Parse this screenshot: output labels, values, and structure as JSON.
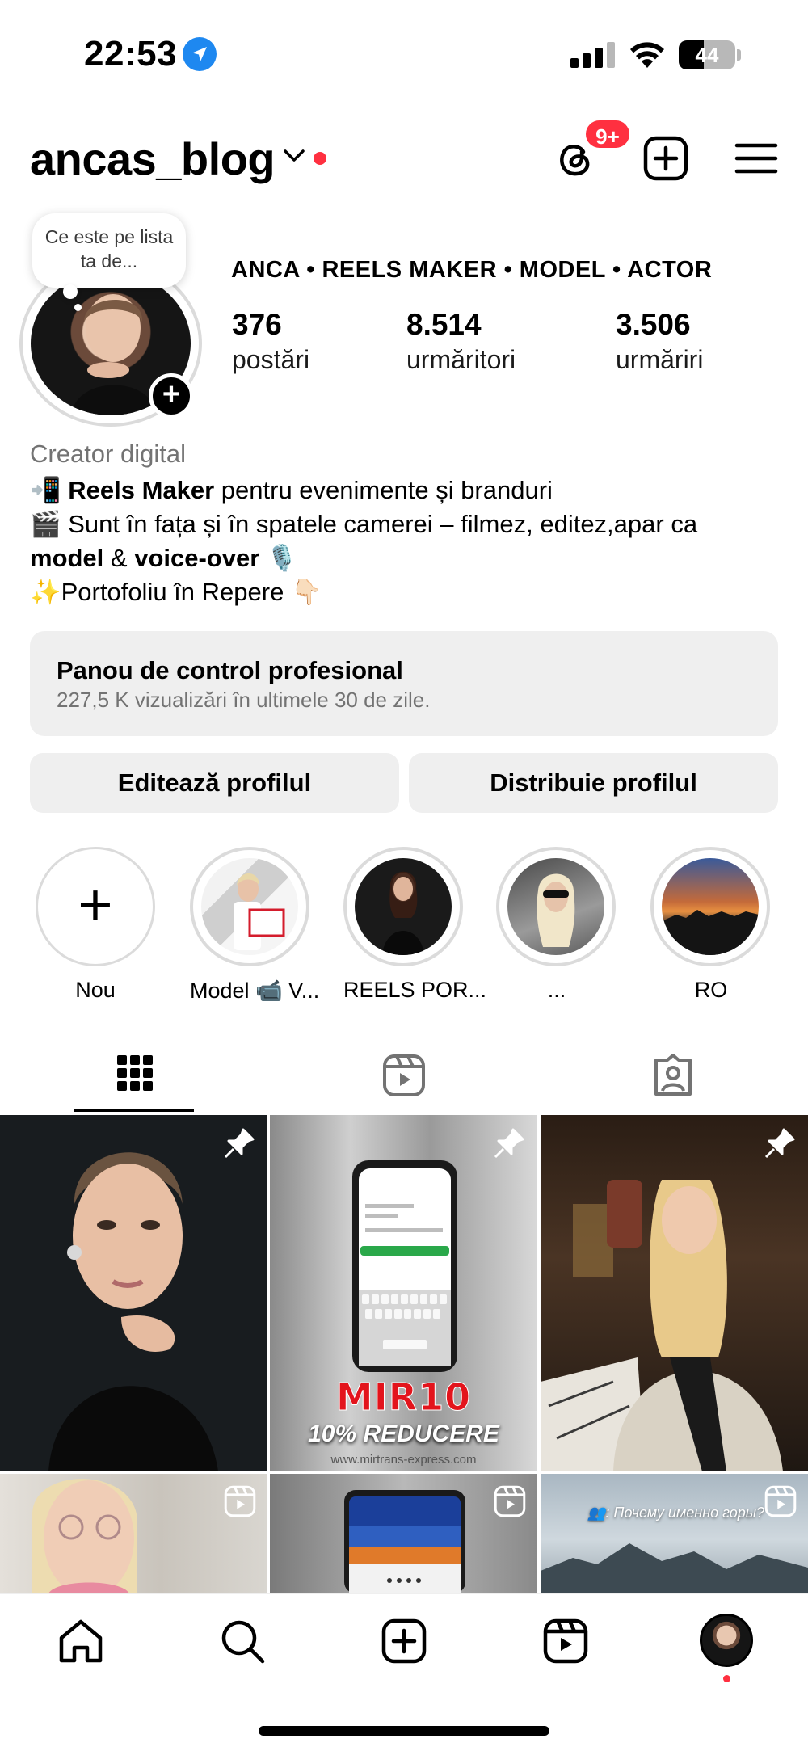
{
  "status_bar": {
    "time": "22:53",
    "battery": "44",
    "battery_level_percent": 44
  },
  "header": {
    "username": "ancas_blog",
    "threads_badge": "9+"
  },
  "profile": {
    "note": "Ce este pe lista ta de...",
    "display_name": "ANCA • REELS MAKER • MODEL • ACTOR",
    "stats": [
      {
        "value": "376",
        "label": "postări"
      },
      {
        "value": "8.514",
        "label": "urmăritori"
      },
      {
        "value": "3.506",
        "label": "urmăriri"
      }
    ],
    "category": "Creator digital",
    "bio": {
      "line1_emoji": "📲",
      "line1_bold": "Reels Maker",
      "line1_rest": " pentru evenimente și branduri",
      "line2_emoji": "🎬",
      "line2_text": " Sunt în fața și în spatele camerei – filmez, editez,apar ca",
      "line3_bold1": "model",
      "line3_mid": " & ",
      "line3_bold2": "voice-over",
      "line3_emoji": " 🎙️",
      "line4_emoji": "✨",
      "line4_text": "Portofoliu în Repere ",
      "line4_emoji2": "👇🏻"
    }
  },
  "dashboard": {
    "title": "Panou de control profesional",
    "subtitle": "227,5 K vizualizări în ultimele 30 de zile."
  },
  "buttons": {
    "edit": "Editează profilul",
    "share": "Distribuie profilul"
  },
  "highlights": [
    {
      "label": "Nou"
    },
    {
      "label": "Model 📹 V..."
    },
    {
      "label": "REELS POR..."
    },
    {
      "label": "..."
    },
    {
      "label": "RO"
    }
  ],
  "grid": {
    "tile2_title": "MIR10",
    "tile2_subtitle": "10% REDUCERE",
    "tile2_url": "www.mirtrans-express.com",
    "tile6_caption": "👥: Почему именно горы?"
  },
  "colors": {
    "accent_red": "#ff3040",
    "location_blue": "#1e88f0",
    "panel_gray": "#efefef"
  }
}
